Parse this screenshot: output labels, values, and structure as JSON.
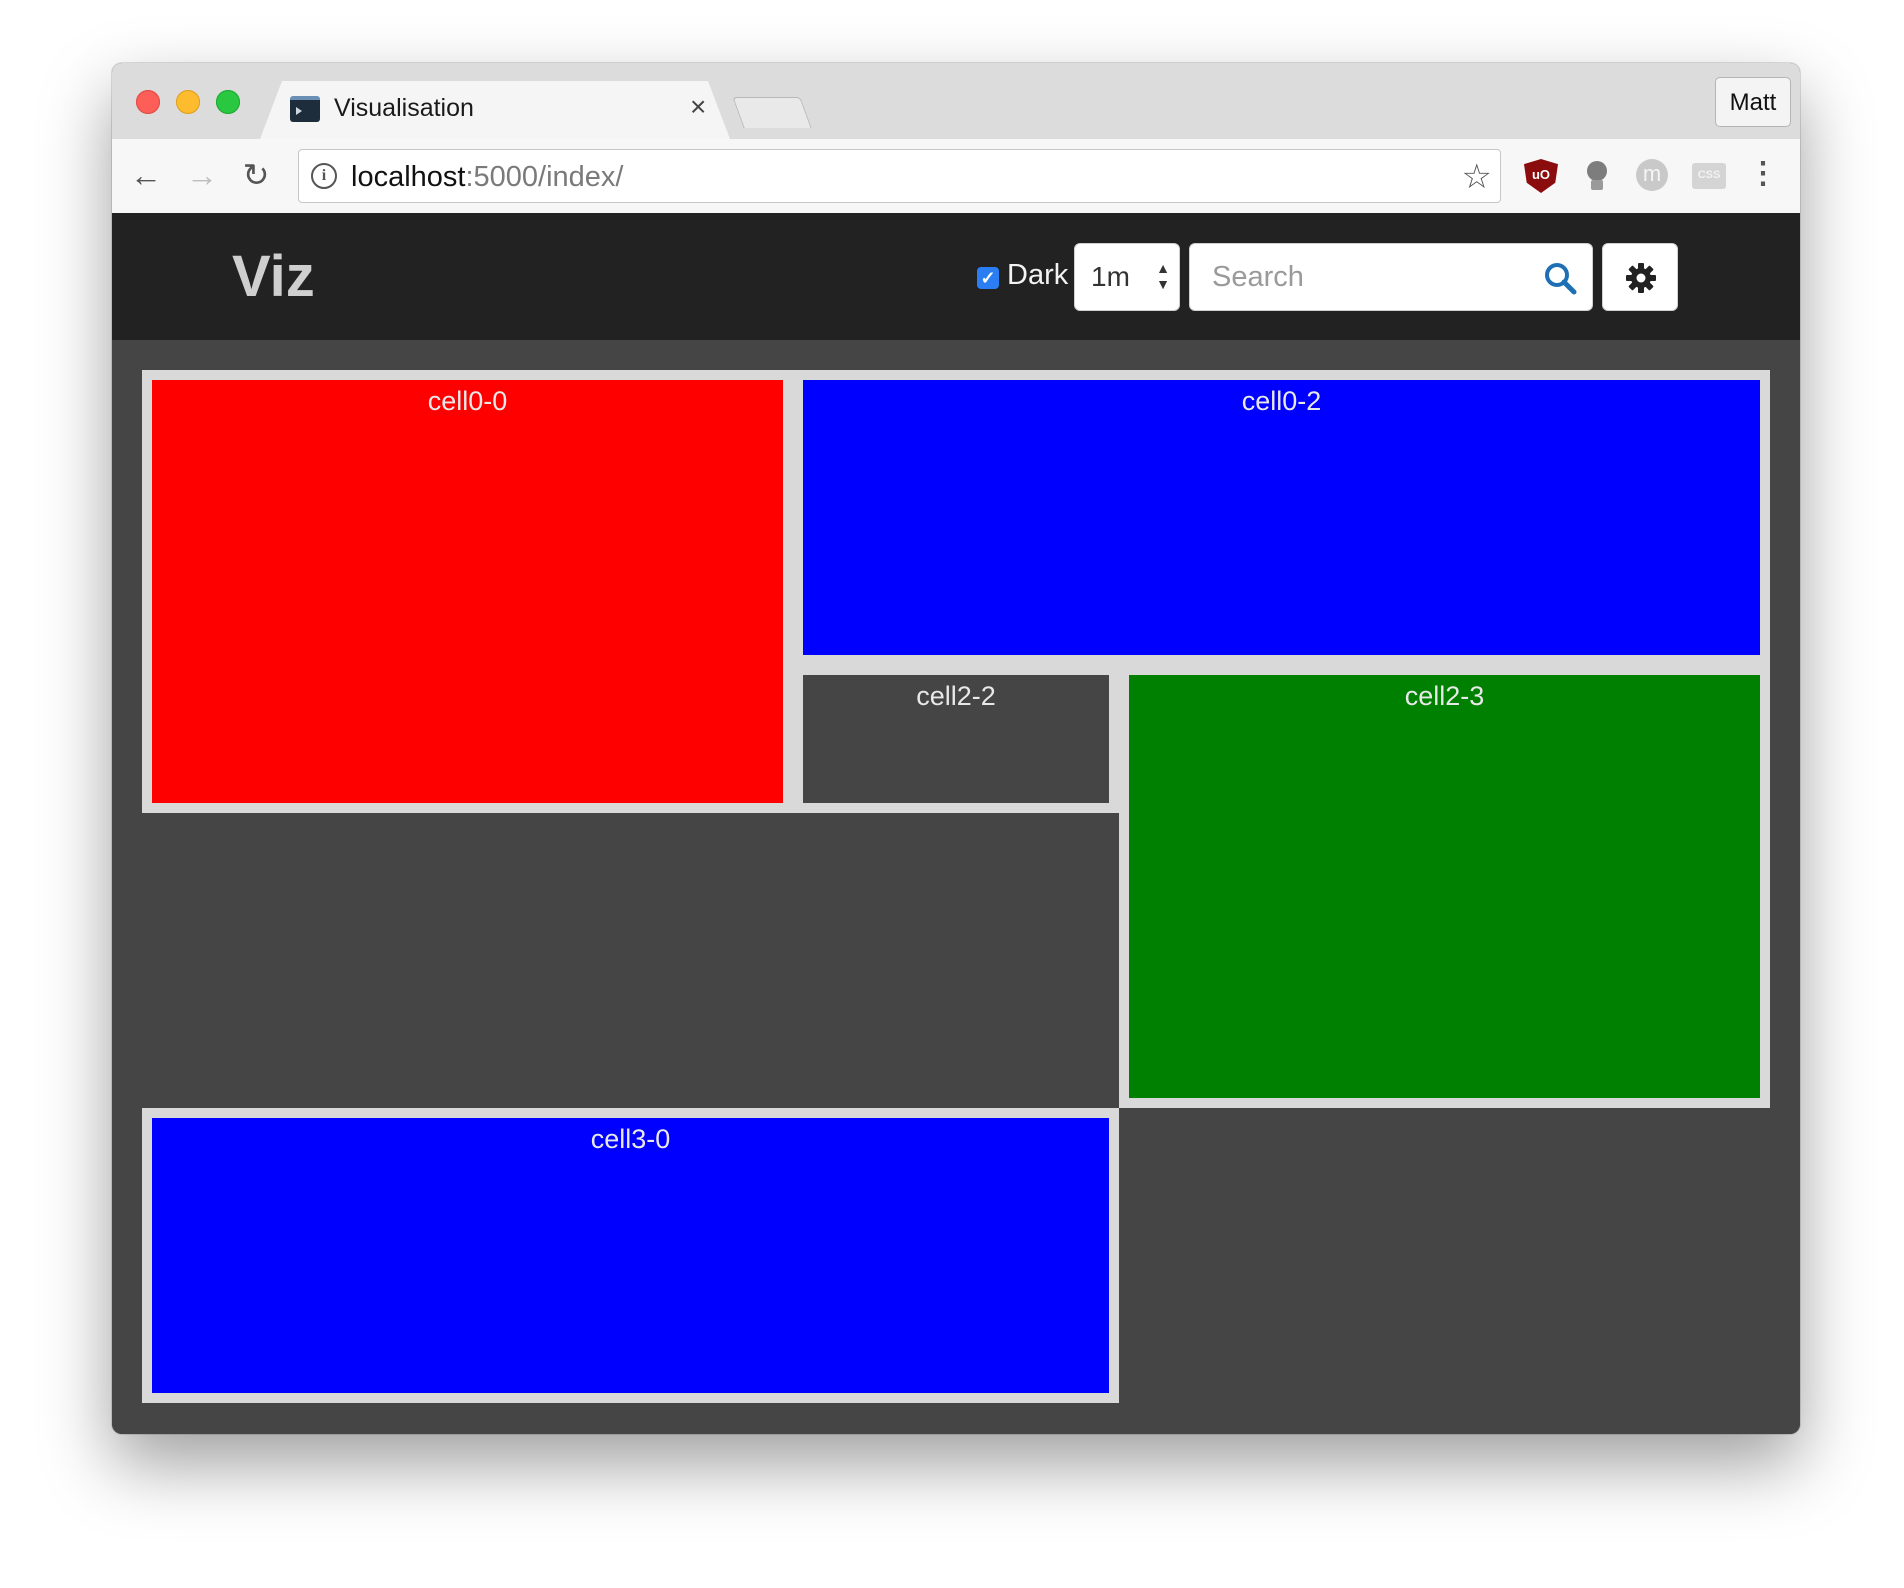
{
  "browser": {
    "tab_title": "Visualisation",
    "tab_close": "×",
    "profile_name": "Matt",
    "url_host": "localhost",
    "url_rest": ":5000/index/",
    "ext_ublock": "uO",
    "ext_m": "m",
    "ext_css": "CSS",
    "menu_glyph": "⋮"
  },
  "app": {
    "brand": "Viz",
    "dark_label": "Dark",
    "dark_checked": true,
    "interval_value": "1m",
    "search_placeholder": "Search"
  },
  "colors": {
    "red": "#ff0000",
    "blue": "#0000ff",
    "green": "#008000",
    "dark": "#454545",
    "cell_border": "#d9d9d9",
    "navbar": "#222222",
    "checkbox": "#2a7df3",
    "search_icon": "#1f6fb5"
  },
  "cells": [
    {
      "label": "cell0-0",
      "color": "#ff0000"
    },
    {
      "label": "cell0-2",
      "color": "#0000ff"
    },
    {
      "label": "cell2-2",
      "color": "#454545"
    },
    {
      "label": "cell2-3",
      "color": "#008000"
    },
    {
      "label": "cell3-0",
      "color": "#0000ff"
    }
  ]
}
